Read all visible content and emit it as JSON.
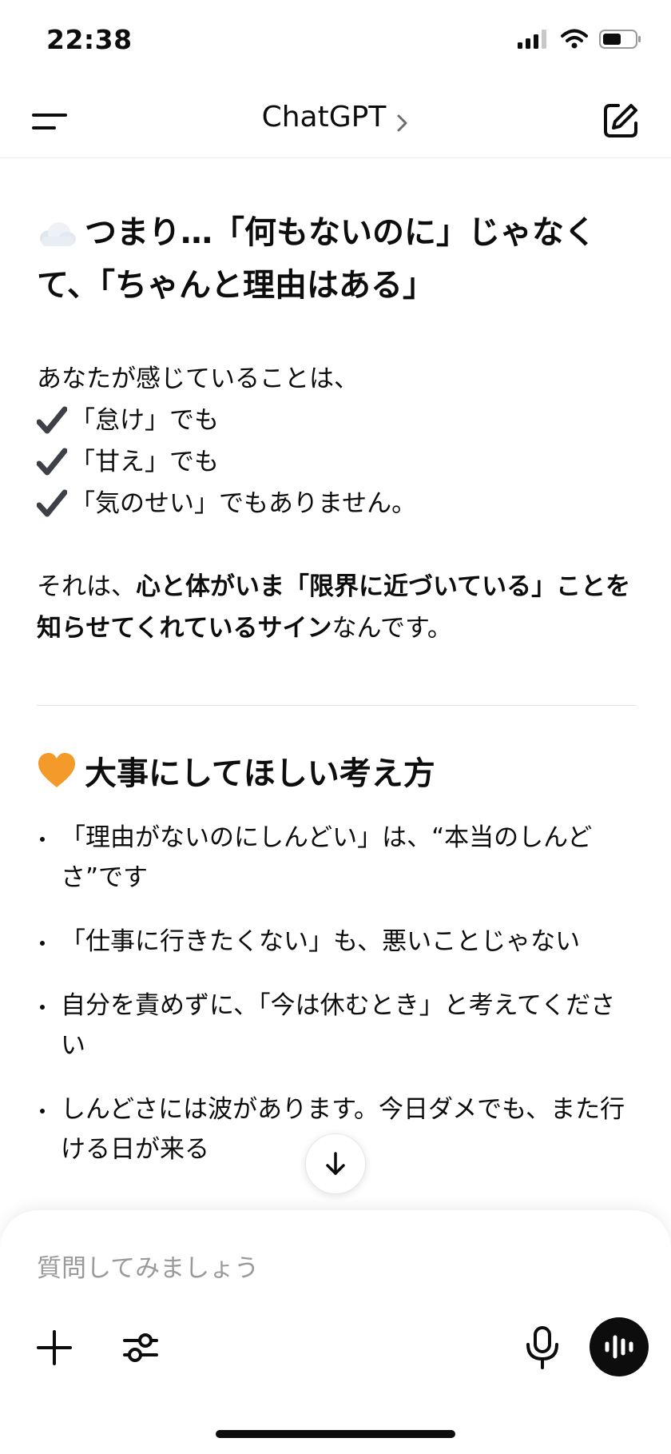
{
  "status_bar": {
    "time": "22:38"
  },
  "nav": {
    "title": "ChatGPT"
  },
  "message": {
    "heading1": "つまり…「何もないのに」じゃなくて、「ちゃんと理由はある」",
    "intro": "あなたが感じていることは、",
    "checks": [
      "「怠け」でも",
      "「甘え」でも",
      "「気のせい」でもありません。"
    ],
    "para2": {
      "lead": "それは、",
      "bold": "心と体がいま「限界に近づいている」ことを知らせてくれているサイン",
      "tail": "なんです。"
    },
    "heading2": "大事にしてほしい考え方",
    "bullets": [
      "「理由がないのにしんどい」は、“本当のしんどさ”です",
      "「仕事に行きたくない」も、悪いことじゃない",
      "自分を責めずに、「今は休むとき」と考えてください",
      "しんどさには波があります。今日ダメでも、また行ける日が来る"
    ]
  },
  "composer": {
    "placeholder": "質問してみましょう"
  },
  "colors": {
    "text": "#0d0d0d",
    "placeholder": "#9a9a9a",
    "heart": "#f39a2b",
    "voice_button": "#0d0d0d"
  },
  "icons": {
    "cloud": "cloud-emoji",
    "heart": "orange-heart-emoji",
    "check": "check-mark-emoji",
    "menu": "menu-icon",
    "edit": "new-chat-icon",
    "scroll": "arrow-down-icon",
    "plus": "plus-icon",
    "tools": "sliders-icon",
    "mic": "microphone-icon",
    "voice": "voice-mode-icon"
  }
}
